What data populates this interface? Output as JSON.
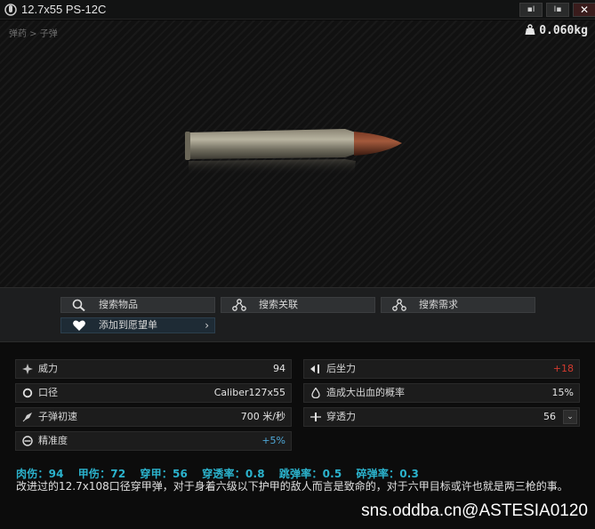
{
  "window": {
    "title": "12.7x55 PS-12C",
    "buttons": {
      "minimize": "▪I",
      "restore": "I▪",
      "close": "✕"
    }
  },
  "preview": {
    "breadcrumb": "弹药 > 子弹",
    "weight": "0.060kg"
  },
  "actions": {
    "search_item": "搜索物品",
    "search_linked": "搜索关联",
    "search_needs": "搜索需求",
    "add_wishlist": "添加到愿望单"
  },
  "stats": {
    "left": [
      {
        "icon": "damage-icon",
        "label": "威力",
        "value": "94"
      },
      {
        "icon": "caliber-icon",
        "label": "口径",
        "value": "Caliber127x55"
      },
      {
        "icon": "velocity-icon",
        "label": "子弹初速",
        "value": "700 米/秒"
      },
      {
        "icon": "accuracy-icon",
        "label": "精准度",
        "value": "+5%"
      }
    ],
    "right": [
      {
        "icon": "recoil-icon",
        "label": "后坐力",
        "value": "+18"
      },
      {
        "icon": "bleed-icon",
        "label": "造成大出血的概率",
        "value": "15%"
      },
      {
        "icon": "penetration-icon",
        "label": "穿透力",
        "value": "56"
      }
    ]
  },
  "summary": {
    "flesh": "肉伤：94",
    "armor": "甲伤：72",
    "pen": "穿甲：56",
    "pen_rate": "穿透率：0.8",
    "ricochet": "跳弹率：0.5",
    "frag": "碎弹率：0.3"
  },
  "description": "改进过的12.7x108口径穿甲弹，对于身着六级以下护甲的敌人而言是致命的，对于六甲目标或许也就是两三枪的事。",
  "watermark": "sns.oddba.cn@ASTESIA0120",
  "colors": {
    "accent": "#2bb3cd",
    "negative": "#d33a2e",
    "positive": "#4fa8d8"
  }
}
